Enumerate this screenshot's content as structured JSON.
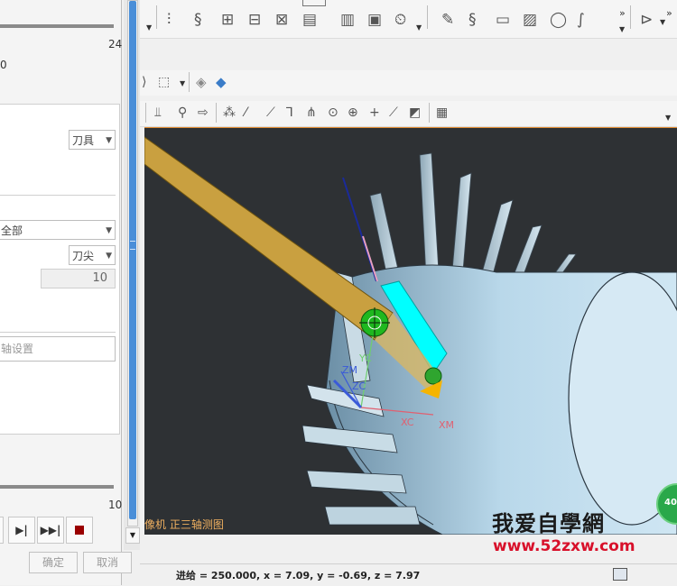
{
  "left_panel": {
    "top_slider_max": "24",
    "top_value_fragment": "0",
    "tool_combo": "刀具",
    "all_combo": "全部",
    "tooltip_combo": "刀尖",
    "number_field": "10",
    "settings_field_placeholder": "轴设置",
    "bottom_slider_max": "10",
    "ok_button": "确定",
    "cancel_button": "取消"
  },
  "viewport": {
    "view_label": "像机 正三轴测图",
    "axis_labels": {
      "zm": "ZM",
      "yc": "YC",
      "zc": "ZC",
      "xc": "XC",
      "xm": "XM"
    },
    "badge": "40"
  },
  "status_bar": {
    "text": "进给 = 250.000, x = 7.09, y = -0.69, z = 7.97"
  },
  "watermark": {
    "text": "我爱自學網",
    "url": "www.52zxw.com"
  },
  "colors": {
    "viewport_bg": "#2e3134",
    "accent_blue": "#4a8ed8",
    "cyan_highlight": "#00ffff",
    "tool_gold": "#c9a040",
    "watermark_red": "#d8102a"
  }
}
